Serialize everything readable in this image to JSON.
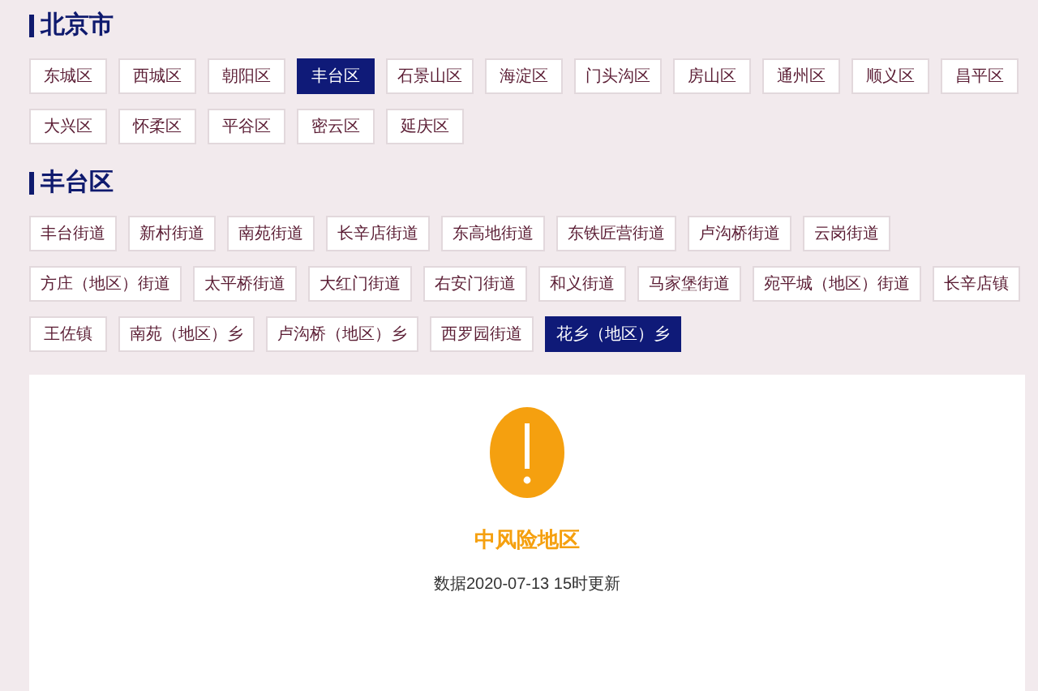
{
  "sections": [
    {
      "title": "北京市",
      "items": [
        {
          "label": "东城区",
          "selected": false
        },
        {
          "label": "西城区",
          "selected": false
        },
        {
          "label": "朝阳区",
          "selected": false
        },
        {
          "label": "丰台区",
          "selected": true
        },
        {
          "label": "石景山区",
          "selected": false
        },
        {
          "label": "海淀区",
          "selected": false
        },
        {
          "label": "门头沟区",
          "selected": false
        },
        {
          "label": "房山区",
          "selected": false
        },
        {
          "label": "通州区",
          "selected": false
        },
        {
          "label": "顺义区",
          "selected": false
        },
        {
          "label": "昌平区",
          "selected": false
        },
        {
          "label": "大兴区",
          "selected": false
        },
        {
          "label": "怀柔区",
          "selected": false
        },
        {
          "label": "平谷区",
          "selected": false
        },
        {
          "label": "密云区",
          "selected": false
        },
        {
          "label": "延庆区",
          "selected": false
        }
      ]
    },
    {
      "title": "丰台区",
      "items": [
        {
          "label": "丰台街道",
          "selected": false
        },
        {
          "label": "新村街道",
          "selected": false
        },
        {
          "label": "南苑街道",
          "selected": false
        },
        {
          "label": "长辛店街道",
          "selected": false
        },
        {
          "label": "东高地街道",
          "selected": false
        },
        {
          "label": "东铁匠营街道",
          "selected": false
        },
        {
          "label": "卢沟桥街道",
          "selected": false
        },
        {
          "label": "云岗街道",
          "selected": false
        },
        {
          "label": "方庄（地区）街道",
          "selected": false
        },
        {
          "label": "太平桥街道",
          "selected": false
        },
        {
          "label": "大红门街道",
          "selected": false
        },
        {
          "label": "右安门街道",
          "selected": false
        },
        {
          "label": "和义街道",
          "selected": false
        },
        {
          "label": "马家堡街道",
          "selected": false
        },
        {
          "label": "宛平城（地区）街道",
          "selected": false
        },
        {
          "label": "长辛店镇",
          "selected": false
        },
        {
          "label": "王佐镇",
          "selected": false
        },
        {
          "label": "南苑（地区）乡",
          "selected": false
        },
        {
          "label": "卢沟桥（地区）乡",
          "selected": false
        },
        {
          "label": "西罗园街道",
          "selected": false
        },
        {
          "label": "花乡（地区）乡",
          "selected": true
        }
      ]
    }
  ],
  "result": {
    "level": "中风险地区",
    "color": "#f5a00f",
    "updated": "数据2020-07-13 15时更新"
  }
}
